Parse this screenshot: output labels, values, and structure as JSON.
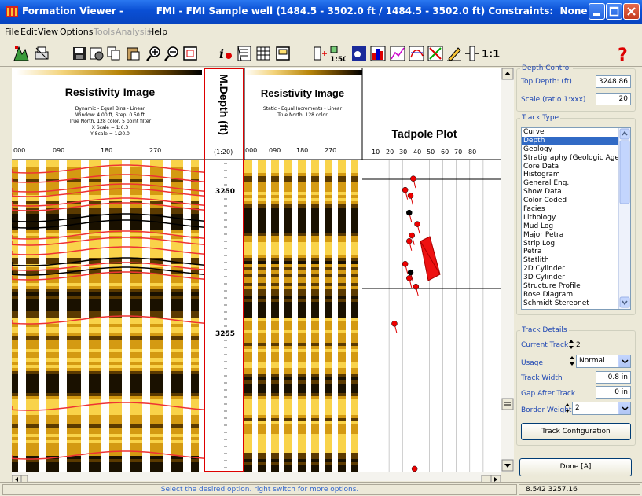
{
  "window": {
    "app_title": "Formation Viewer -",
    "doc_title": "FMI - FMI Sample well (1484.5 - 3502.0 ft / 1484.5 - 3502.0 ft) Constraints:  None",
    "buttons": [
      "minimize-icon",
      "maximize-icon",
      "close-icon"
    ],
    "accent": "#0a4fd4"
  },
  "menu": {
    "items": [
      {
        "label": "File",
        "enabled": true
      },
      {
        "label": "Edit",
        "enabled": true
      },
      {
        "label": "View",
        "enabled": true
      },
      {
        "label": "Options",
        "enabled": true
      },
      {
        "label": "Tools",
        "enabled": false
      },
      {
        "label": "Analysis",
        "enabled": false
      },
      {
        "label": "Help",
        "enabled": true
      }
    ]
  },
  "toolbar": {
    "scale_150": "1:50",
    "scale_11": "1:1",
    "help_icon": "question-icon"
  },
  "tracks": {
    "dynamic": {
      "title": "Resistivity Image",
      "sub1": "Dynamic - Equal Bins - Linear",
      "sub2": "Window: 4.00 ft, Step: 0.50 ft",
      "sub3": "True North, 128 color, 5 point filter",
      "sub4": "X Scale = 1:6.3",
      "sub5": "Y Scale = 1:20.0",
      "ticks": [
        "000",
        "090",
        "180",
        "270"
      ]
    },
    "depth": {
      "title": "M.Depth (ft)",
      "scale": "(1:20)",
      "labels": [
        "3250",
        "3255"
      ]
    },
    "static": {
      "title": "Resistivity Image",
      "sub1": "Static - Equal Increments - Linear",
      "sub2": "True North, 128 color",
      "ticks": [
        "000",
        "090",
        "180",
        "270"
      ]
    },
    "tadpole": {
      "title": "Tadpole Plot",
      "ticks": [
        "10",
        "20",
        "30",
        "40",
        "50",
        "60",
        "70",
        "80"
      ]
    }
  },
  "chart_data": {
    "type": "scatter",
    "title": "Tadpole Plot",
    "xlim": [
      0,
      90
    ],
    "x_ticks": [
      10,
      20,
      30,
      40,
      50,
      60,
      70,
      80
    ],
    "points": [
      {
        "depth": 3249.5,
        "dip": 28,
        "color": "red"
      },
      {
        "depth": 3249.9,
        "dip": 22,
        "color": "red"
      },
      {
        "depth": 3250.1,
        "dip": 26,
        "color": "red"
      },
      {
        "depth": 3250.7,
        "dip": 25,
        "color": "black"
      },
      {
        "depth": 3251.1,
        "dip": 31,
        "color": "red"
      },
      {
        "depth": 3251.5,
        "dip": 27,
        "color": "red"
      },
      {
        "depth": 3251.7,
        "dip": 25,
        "color": "red"
      },
      {
        "depth": 3252.5,
        "dip": 22,
        "color": "red"
      },
      {
        "depth": 3252.8,
        "dip": 26,
        "color": "black"
      },
      {
        "depth": 3253.0,
        "dip": 25,
        "color": "red"
      },
      {
        "depth": 3253.3,
        "dip": 30,
        "color": "red"
      },
      {
        "depth": 3254.6,
        "dip": 14,
        "color": "red"
      },
      {
        "depth": 3259.7,
        "dip": 29,
        "color": "red"
      }
    ]
  },
  "panel": {
    "depth_control": {
      "legend": "Depth Control",
      "top_depth_label": "Top Depth: (ft)",
      "top_depth_value": "3248.86",
      "scale_label": "Scale (ratio 1:xxx)",
      "scale_value": "20"
    },
    "track_type": {
      "legend": "Track Type",
      "items": [
        "Curve",
        "Depth",
        "Geology",
        "Stratigraphy (Geologic Age)",
        "Core Data",
        "Histogram",
        "General Eng.",
        "Show Data",
        "Color Coded",
        "Facies",
        "Lithology",
        "Mud Log",
        "Major Petra",
        "Strip Log",
        "Petra",
        "Statlith",
        "2D Cylinder",
        "3D Cylinder",
        "Structure Profile",
        "Rose Diagram",
        "Schmidt Stereonet"
      ],
      "selected": "Depth"
    },
    "track_details": {
      "legend": "Track Details",
      "current_track_label": "Current Track",
      "current_track_value": "2",
      "usage_label": "Usage",
      "usage_value": "Normal",
      "width_label": "Track Width",
      "width_value": "0.8 in",
      "gap_label": "Gap After Track",
      "gap_value": "0 in",
      "border_label": "Border Weight",
      "border_value": "2",
      "config_button": "Track Configuration"
    },
    "done_button": "Done [A]"
  },
  "status": {
    "message": "Select the desired option. right switch for more options.",
    "coords": "8.542  3257.16"
  }
}
